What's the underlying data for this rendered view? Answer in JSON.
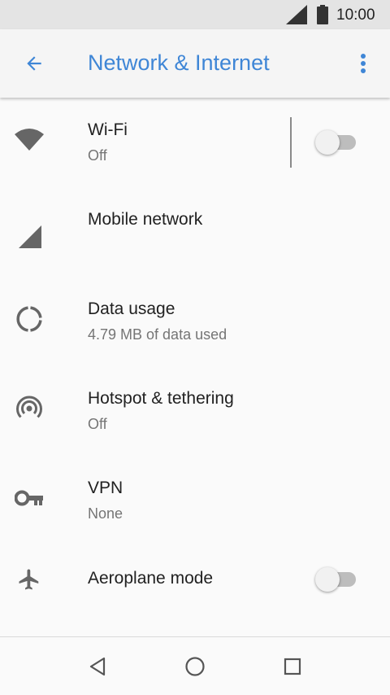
{
  "status": {
    "time": "10:00",
    "signal_icon": "signal-icon",
    "battery_icon": "battery-icon"
  },
  "appbar": {
    "title": "Network & Internet",
    "back_icon": "arrow-back-icon",
    "more_icon": "more-vert-icon"
  },
  "colors": {
    "accent": "#3f86d6",
    "icon": "#666666",
    "switch_off_track": "#bdbdbd"
  },
  "items": [
    {
      "title": "Wi-Fi",
      "subtitle": "Off",
      "icon": "wifi-icon",
      "toggle": "off"
    },
    {
      "title": "Mobile network",
      "subtitle": "",
      "icon": "cellular-icon"
    },
    {
      "title": "Data usage",
      "subtitle": "4.79 MB of data used",
      "icon": "data-usage-icon"
    },
    {
      "title": "Hotspot & tethering",
      "subtitle": "Off",
      "icon": "hotspot-icon"
    },
    {
      "title": "VPN",
      "subtitle": "None",
      "icon": "vpn-key-icon"
    },
    {
      "title": "Aeroplane mode",
      "subtitle": "",
      "icon": "airplane-icon",
      "toggle": "off"
    }
  ],
  "navbar": {
    "back": "nav-back-icon",
    "home": "nav-home-icon",
    "recents": "nav-recents-icon"
  }
}
